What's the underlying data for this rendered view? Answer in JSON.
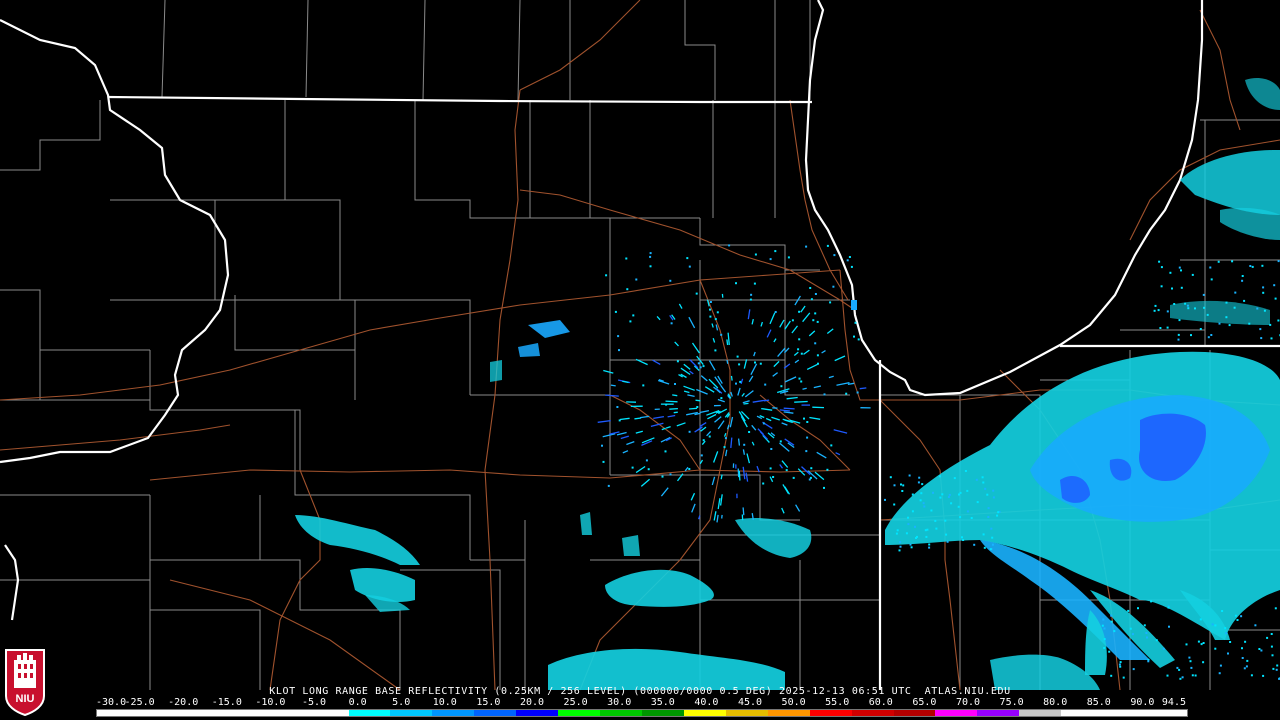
{
  "caption": "KLOT LONG RANGE BASE REFLECTIVITY (0.25KM / 256 LEVEL) (000000/0000 0.5 DEG) 2025-12-13 06:51 UTC  ATLAS.NIU.EDU",
  "logo": {
    "icon": "niu-huskie-tower-logo",
    "text": "NIU",
    "color": "#c8102e"
  },
  "scale": {
    "labels": [
      "-30.0",
      "-25.0",
      "-20.0",
      "-15.0",
      "-10.0",
      "-5.0",
      "0.0",
      "5.0",
      "10.0",
      "15.0",
      "20.0",
      "25.0",
      "30.0",
      "35.0",
      "40.0",
      "45.0",
      "50.0",
      "55.0",
      "60.0",
      "65.0",
      "70.0",
      "75.0",
      "80.0",
      "85.0",
      "90.0",
      "94.5"
    ],
    "colors": [
      "#ffffff",
      "#ffffff",
      "#ffffff",
      "#ffffff",
      "#ffffff",
      "#ffffff",
      "#00ffff",
      "#00c8ff",
      "#0096ff",
      "#0064ff",
      "#0000ff",
      "#00ff00",
      "#00c800",
      "#009600",
      "#ffff00",
      "#e6be00",
      "#ff9600",
      "#ff0000",
      "#d20000",
      "#b40000",
      "#ff00ff",
      "#9600ff",
      "#c8c8c8",
      "#ffffff",
      "#ffffff",
      "#ffffff"
    ]
  },
  "colors": {
    "state_border": "#ffffff",
    "county_line": "#8a8a8a",
    "highway": "#a0522d",
    "echo_light": "#00e5ff",
    "echo_mid": "#19b3ff",
    "echo_strong": "#1e5aff"
  }
}
